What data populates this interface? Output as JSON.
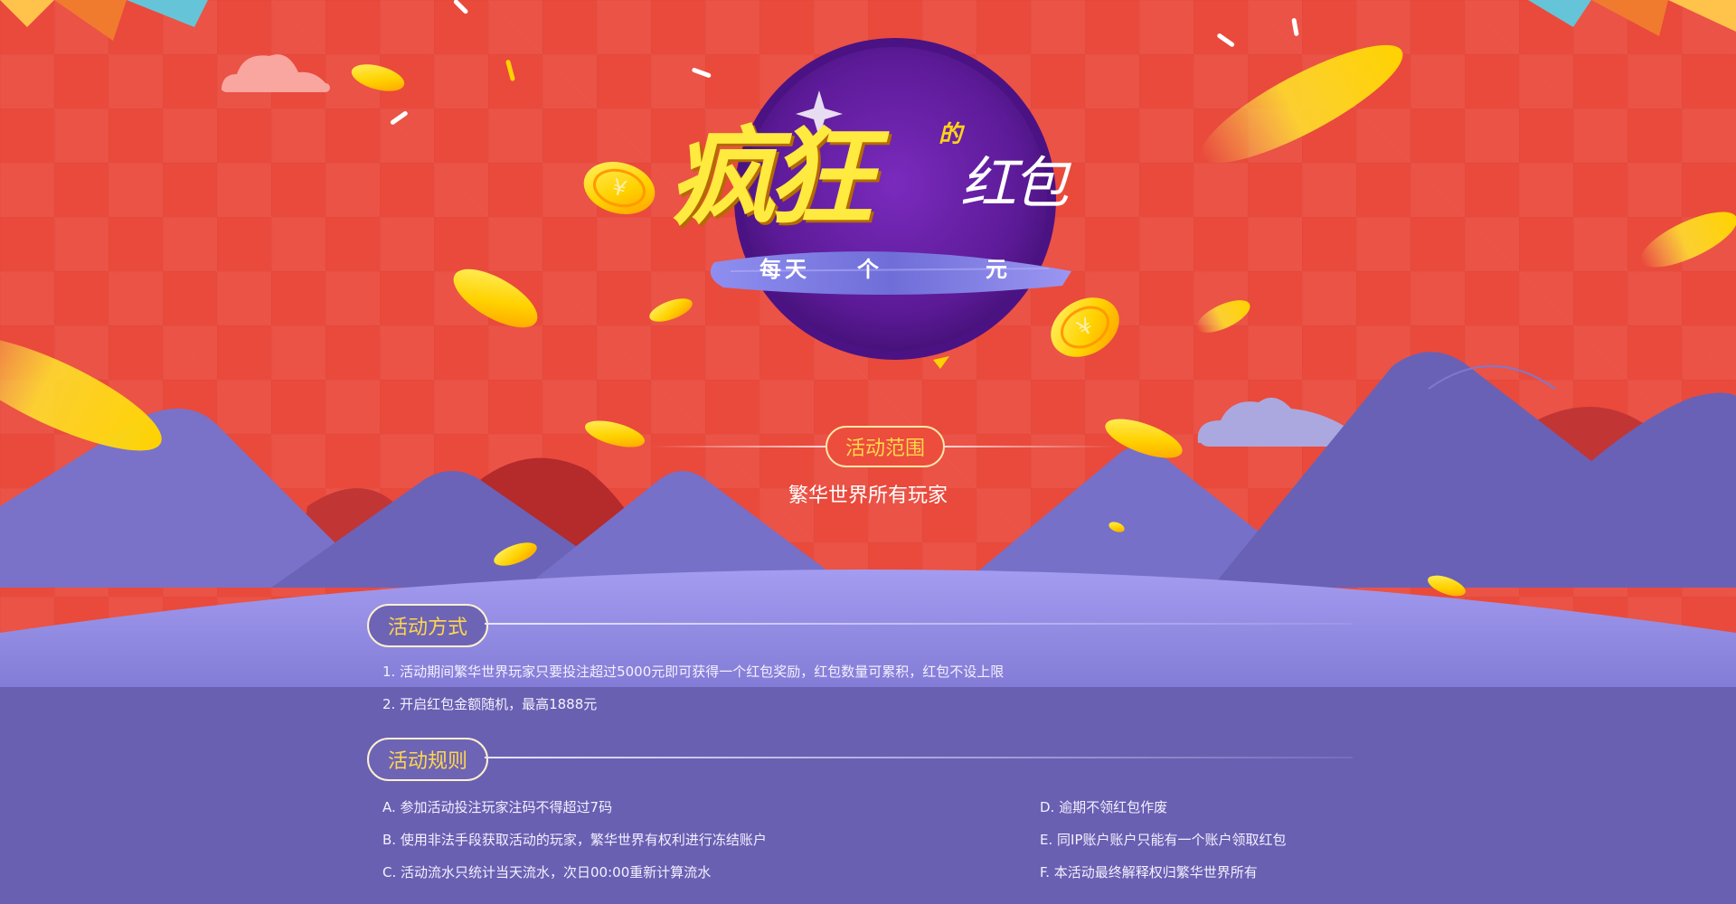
{
  "hero": {
    "title_main": "疯狂",
    "title_de": "的",
    "title_tail": "红包",
    "slogan_1": "每天",
    "slogan_2": "个",
    "slogan_3": "元"
  },
  "range": {
    "label": "活动范围",
    "text": "繁华世界所有玩家"
  },
  "method": {
    "label": "活动方式",
    "items": [
      "1. 活动期间繁华世界玩家只要投注超过5000元即可获得一个红包奖励，红包数量可累积，红包不设上限",
      "2. 开启红包金额随机，最高1888元"
    ]
  },
  "rules": {
    "label": "活动规则",
    "left": [
      "A. 参加活动投注玩家注码不得超过7码",
      "B. 使用非法手段获取活动的玩家，繁华世界有权利进行冻结账户",
      "C. 活动流水只统计当天流水，次日00:00重新计算流水"
    ],
    "right": [
      "D. 逾期不领红包作废",
      "E. 同IP账户账户只能有一个账户领取红包",
      "F. 本活动最终解释权归繁华世界所有"
    ]
  },
  "colors": {
    "red_bg": "#e94a3c",
    "purple_bg": "#6960b2",
    "accent_yellow": "#ffd64c",
    "purple_circle": "#6a1fa2"
  }
}
